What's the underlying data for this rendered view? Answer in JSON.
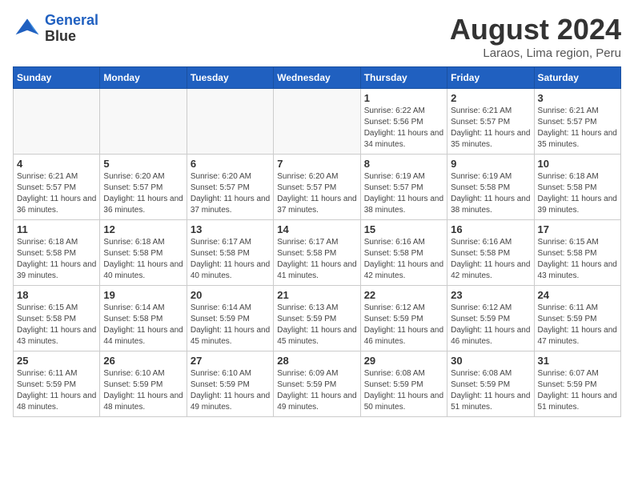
{
  "header": {
    "logo_line1": "General",
    "logo_line2": "Blue",
    "month_title": "August 2024",
    "location": "Laraos, Lima region, Peru"
  },
  "weekdays": [
    "Sunday",
    "Monday",
    "Tuesday",
    "Wednesday",
    "Thursday",
    "Friday",
    "Saturday"
  ],
  "weeks": [
    [
      {
        "day": "",
        "empty": true
      },
      {
        "day": "",
        "empty": true
      },
      {
        "day": "",
        "empty": true
      },
      {
        "day": "",
        "empty": true
      },
      {
        "day": "1",
        "sunrise": "6:22 AM",
        "sunset": "5:56 PM",
        "daylight": "11 hours and 34 minutes."
      },
      {
        "day": "2",
        "sunrise": "6:21 AM",
        "sunset": "5:57 PM",
        "daylight": "11 hours and 35 minutes."
      },
      {
        "day": "3",
        "sunrise": "6:21 AM",
        "sunset": "5:57 PM",
        "daylight": "11 hours and 35 minutes."
      }
    ],
    [
      {
        "day": "4",
        "sunrise": "6:21 AM",
        "sunset": "5:57 PM",
        "daylight": "11 hours and 36 minutes."
      },
      {
        "day": "5",
        "sunrise": "6:20 AM",
        "sunset": "5:57 PM",
        "daylight": "11 hours and 36 minutes."
      },
      {
        "day": "6",
        "sunrise": "6:20 AM",
        "sunset": "5:57 PM",
        "daylight": "11 hours and 37 minutes."
      },
      {
        "day": "7",
        "sunrise": "6:20 AM",
        "sunset": "5:57 PM",
        "daylight": "11 hours and 37 minutes."
      },
      {
        "day": "8",
        "sunrise": "6:19 AM",
        "sunset": "5:57 PM",
        "daylight": "11 hours and 38 minutes."
      },
      {
        "day": "9",
        "sunrise": "6:19 AM",
        "sunset": "5:58 PM",
        "daylight": "11 hours and 38 minutes."
      },
      {
        "day": "10",
        "sunrise": "6:18 AM",
        "sunset": "5:58 PM",
        "daylight": "11 hours and 39 minutes."
      }
    ],
    [
      {
        "day": "11",
        "sunrise": "6:18 AM",
        "sunset": "5:58 PM",
        "daylight": "11 hours and 39 minutes."
      },
      {
        "day": "12",
        "sunrise": "6:18 AM",
        "sunset": "5:58 PM",
        "daylight": "11 hours and 40 minutes."
      },
      {
        "day": "13",
        "sunrise": "6:17 AM",
        "sunset": "5:58 PM",
        "daylight": "11 hours and 40 minutes."
      },
      {
        "day": "14",
        "sunrise": "6:17 AM",
        "sunset": "5:58 PM",
        "daylight": "11 hours and 41 minutes."
      },
      {
        "day": "15",
        "sunrise": "6:16 AM",
        "sunset": "5:58 PM",
        "daylight": "11 hours and 42 minutes."
      },
      {
        "day": "16",
        "sunrise": "6:16 AM",
        "sunset": "5:58 PM",
        "daylight": "11 hours and 42 minutes."
      },
      {
        "day": "17",
        "sunrise": "6:15 AM",
        "sunset": "5:58 PM",
        "daylight": "11 hours and 43 minutes."
      }
    ],
    [
      {
        "day": "18",
        "sunrise": "6:15 AM",
        "sunset": "5:58 PM",
        "daylight": "11 hours and 43 minutes."
      },
      {
        "day": "19",
        "sunrise": "6:14 AM",
        "sunset": "5:58 PM",
        "daylight": "11 hours and 44 minutes."
      },
      {
        "day": "20",
        "sunrise": "6:14 AM",
        "sunset": "5:59 PM",
        "daylight": "11 hours and 45 minutes."
      },
      {
        "day": "21",
        "sunrise": "6:13 AM",
        "sunset": "5:59 PM",
        "daylight": "11 hours and 45 minutes."
      },
      {
        "day": "22",
        "sunrise": "6:12 AM",
        "sunset": "5:59 PM",
        "daylight": "11 hours and 46 minutes."
      },
      {
        "day": "23",
        "sunrise": "6:12 AM",
        "sunset": "5:59 PM",
        "daylight": "11 hours and 46 minutes."
      },
      {
        "day": "24",
        "sunrise": "6:11 AM",
        "sunset": "5:59 PM",
        "daylight": "11 hours and 47 minutes."
      }
    ],
    [
      {
        "day": "25",
        "sunrise": "6:11 AM",
        "sunset": "5:59 PM",
        "daylight": "11 hours and 48 minutes."
      },
      {
        "day": "26",
        "sunrise": "6:10 AM",
        "sunset": "5:59 PM",
        "daylight": "11 hours and 48 minutes."
      },
      {
        "day": "27",
        "sunrise": "6:10 AM",
        "sunset": "5:59 PM",
        "daylight": "11 hours and 49 minutes."
      },
      {
        "day": "28",
        "sunrise": "6:09 AM",
        "sunset": "5:59 PM",
        "daylight": "11 hours and 49 minutes."
      },
      {
        "day": "29",
        "sunrise": "6:08 AM",
        "sunset": "5:59 PM",
        "daylight": "11 hours and 50 minutes."
      },
      {
        "day": "30",
        "sunrise": "6:08 AM",
        "sunset": "5:59 PM",
        "daylight": "11 hours and 51 minutes."
      },
      {
        "day": "31",
        "sunrise": "6:07 AM",
        "sunset": "5:59 PM",
        "daylight": "11 hours and 51 minutes."
      }
    ]
  ]
}
